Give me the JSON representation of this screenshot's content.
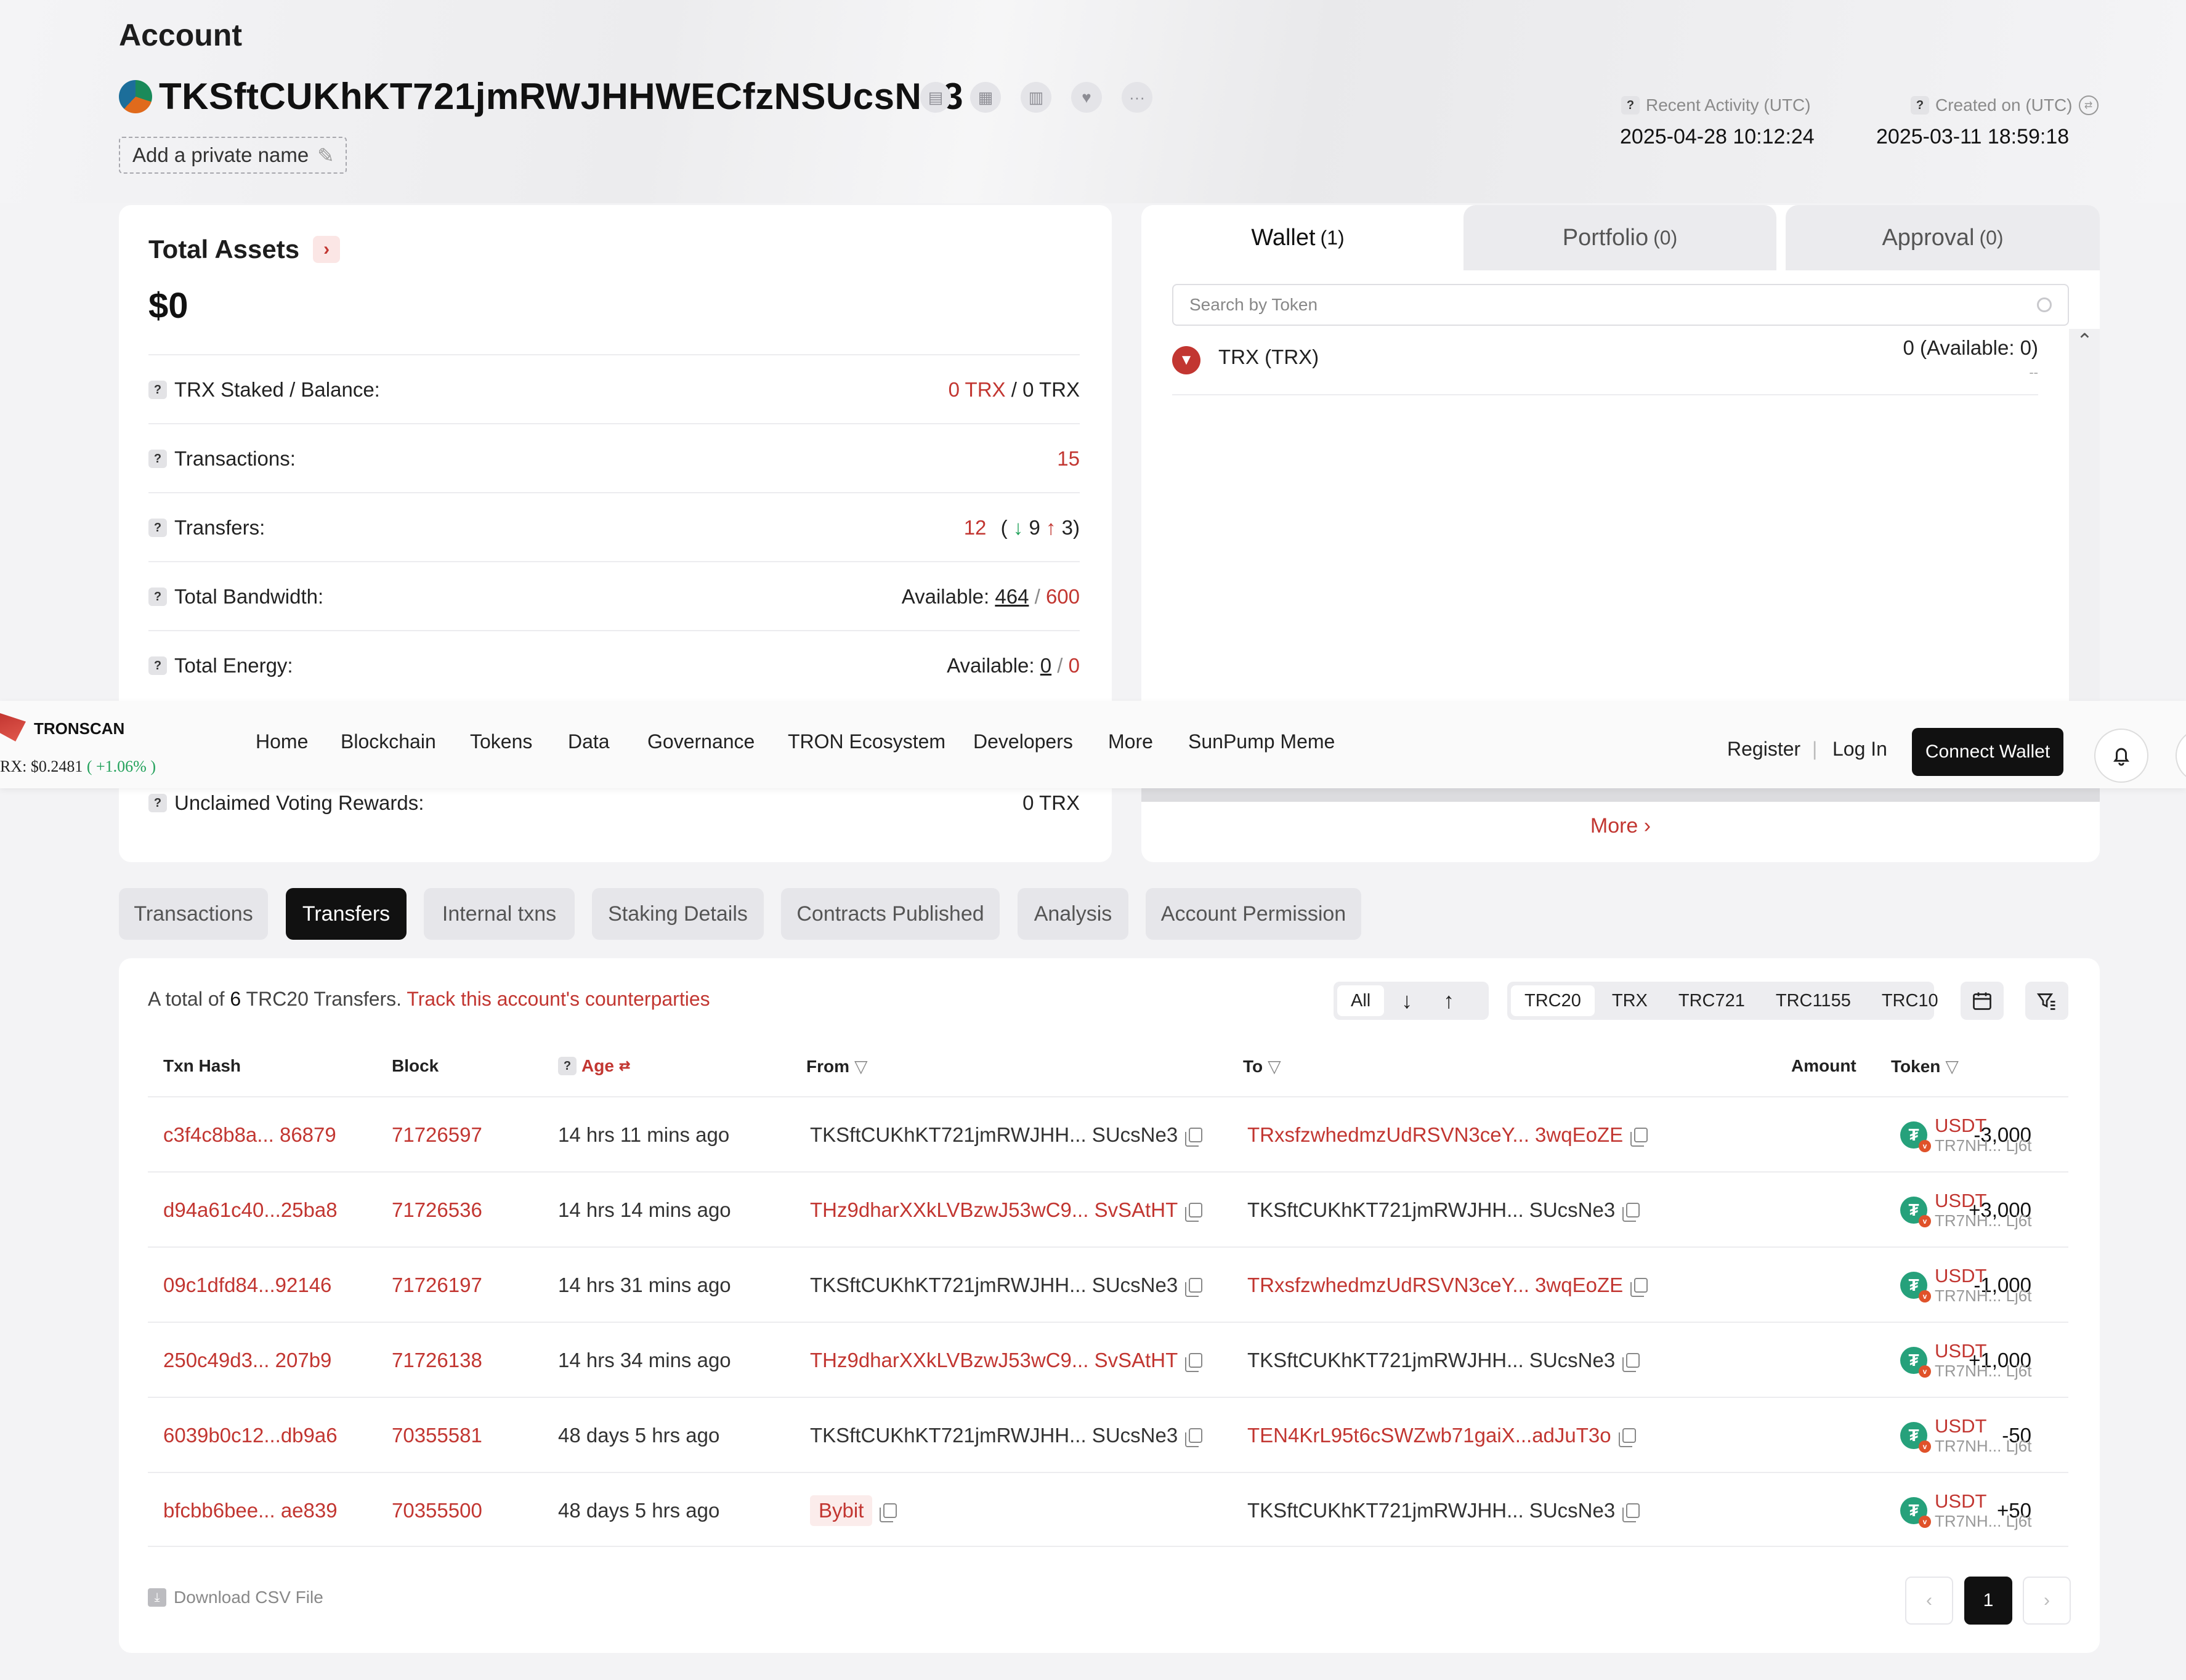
{
  "header": {
    "title": "Account",
    "address": "TKSftCUKhKT721jmRWJHHWECfzNSUcsNe3",
    "private_name_placeholder": "Add a private name",
    "recent_activity_label": "Recent Activity (UTC)",
    "recent_activity_value": "2025-04-28 10:12:24",
    "created_on_label": "Created on (UTC)",
    "created_on_value": "2025-03-11 18:59:18",
    "action_icons": [
      "copy-icon",
      "qrcode-icon",
      "chart-icon",
      "heart-icon",
      "more-icon"
    ]
  },
  "assets": {
    "title": "Total Assets",
    "total": "$0",
    "rows": {
      "trx_staked_label": "TRX Staked / Balance:",
      "trx_staked_value": "0 TRX",
      "trx_balance_value": "/ 0 TRX",
      "transactions_label": "Transactions:",
      "transactions_value": "15",
      "transfers_label": "Transfers:",
      "transfers_total": "12",
      "transfers_open": "(",
      "transfers_in": "9",
      "transfers_out": "3",
      "transfers_close": ")",
      "bandwidth_label": "Total Bandwidth:",
      "bandwidth_available_label": "Available:",
      "bandwidth_available": "464",
      "bandwidth_sep": "/",
      "bandwidth_total": "600",
      "energy_label": "Total Energy:",
      "energy_available_label": "Available:",
      "energy_available": "0",
      "energy_sep": "/",
      "energy_total": "0",
      "voting_label": "Unclaimed Voting Rewards:",
      "voting_value": "0 TRX"
    }
  },
  "wallet": {
    "tabs": [
      {
        "label": "Wallet",
        "count": "(1)"
      },
      {
        "label": "Portfolio",
        "count": "(0)"
      },
      {
        "label": "Approval",
        "count": "(0)"
      }
    ],
    "search_placeholder": "Search by Token",
    "token_name": "TRX (TRX)",
    "token_amount": "0 (Available: 0)",
    "token_sub": "--",
    "more_label": "More"
  },
  "nav": {
    "brand": "TRONSCAN",
    "price_label": "RX: $0.2481",
    "price_change": "( +1.06% )",
    "items": [
      "Home",
      "Blockchain",
      "Tokens",
      "Data",
      "Governance",
      "TRON Ecosystem",
      "Developers",
      "More",
      "SunPump Meme"
    ],
    "register": "Register",
    "divider": "|",
    "login": "Log In",
    "connect": "Connect Wallet"
  },
  "page_tabs": [
    "Transactions",
    "Transfers",
    "Internal txns",
    "Staking Details",
    "Contracts Published",
    "Analysis",
    "Account Permission"
  ],
  "transfers": {
    "summary_prefix": "A total of",
    "summary_count": "6",
    "summary_suffix": "TRC20 Transfers.",
    "track_link": "Track this account's counterparties",
    "direction_filter": {
      "all": "All"
    },
    "token_types": [
      "TRC20",
      "TRX",
      "TRC721",
      "TRC1155",
      "TRC10"
    ],
    "columns": {
      "hash": "Txn Hash",
      "block": "Block",
      "age": "Age",
      "from": "From",
      "to": "To",
      "amount": "Amount",
      "token": "Token"
    },
    "rows": [
      {
        "hash": "c3f4c8b8a... 86879",
        "block": "71726597",
        "age": "14 hrs 11 mins ago",
        "from": "TKSftCUKhKT721jmRWJHH... SUcsNe3",
        "from_link": false,
        "to": "TRxsfzwhedmzUdRSVN3ceY... 3wqEoZE",
        "to_link": true,
        "amount": "-3,000",
        "token": "USDT",
        "token_addr": "TR7NH... Lj6t"
      },
      {
        "hash": "d94a61c40...25ba8",
        "block": "71726536",
        "age": "14 hrs 14 mins ago",
        "from": "THz9dharXXkLVBzwJ53wC9... SvSAtHT",
        "from_link": true,
        "to": "TKSftCUKhKT721jmRWJHH... SUcsNe3",
        "to_link": false,
        "amount": "+3,000",
        "token": "USDT",
        "token_addr": "TR7NH... Lj6t"
      },
      {
        "hash": "09c1dfd84...92146",
        "block": "71726197",
        "age": "14 hrs 31 mins ago",
        "from": "TKSftCUKhKT721jmRWJHH... SUcsNe3",
        "from_link": false,
        "to": "TRxsfzwhedmzUdRSVN3ceY... 3wqEoZE",
        "to_link": true,
        "amount": "-1,000",
        "token": "USDT",
        "token_addr": "TR7NH... Lj6t"
      },
      {
        "hash": "250c49d3... 207b9",
        "block": "71726138",
        "age": "14 hrs 34 mins ago",
        "from": "THz9dharXXkLVBzwJ53wC9... SvSAtHT",
        "from_link": true,
        "to": "TKSftCUKhKT721jmRWJHH... SUcsNe3",
        "to_link": false,
        "amount": "+1,000",
        "token": "USDT",
        "token_addr": "TR7NH... Lj6t"
      },
      {
        "hash": "6039b0c12...db9a6",
        "block": "70355581",
        "age": "48 days 5 hrs ago",
        "from": "TKSftCUKhKT721jmRWJHH... SUcsNe3",
        "from_link": false,
        "to": "TEN4KrL95t6cSWZwb71gaiX...adJuT3o",
        "to_link": true,
        "amount": "-50",
        "token": "USDT",
        "token_addr": "TR7NH... Lj6t"
      },
      {
        "hash": "bfcbb6bee... ae839",
        "block": "70355500",
        "age": "48 days 5 hrs ago",
        "from": "Bybit",
        "from_link": true,
        "to": "TKSftCUKhKT721jmRWJHH... SUcsNe3",
        "to_link": false,
        "amount": "+50",
        "token": "USDT",
        "token_addr": "TR7NH... Lj6t"
      }
    ],
    "download_label": "Download CSV File",
    "current_page": "1"
  },
  "colors": {
    "accent": "#c23631",
    "positive": "#21a15a",
    "dark": "#111111"
  }
}
